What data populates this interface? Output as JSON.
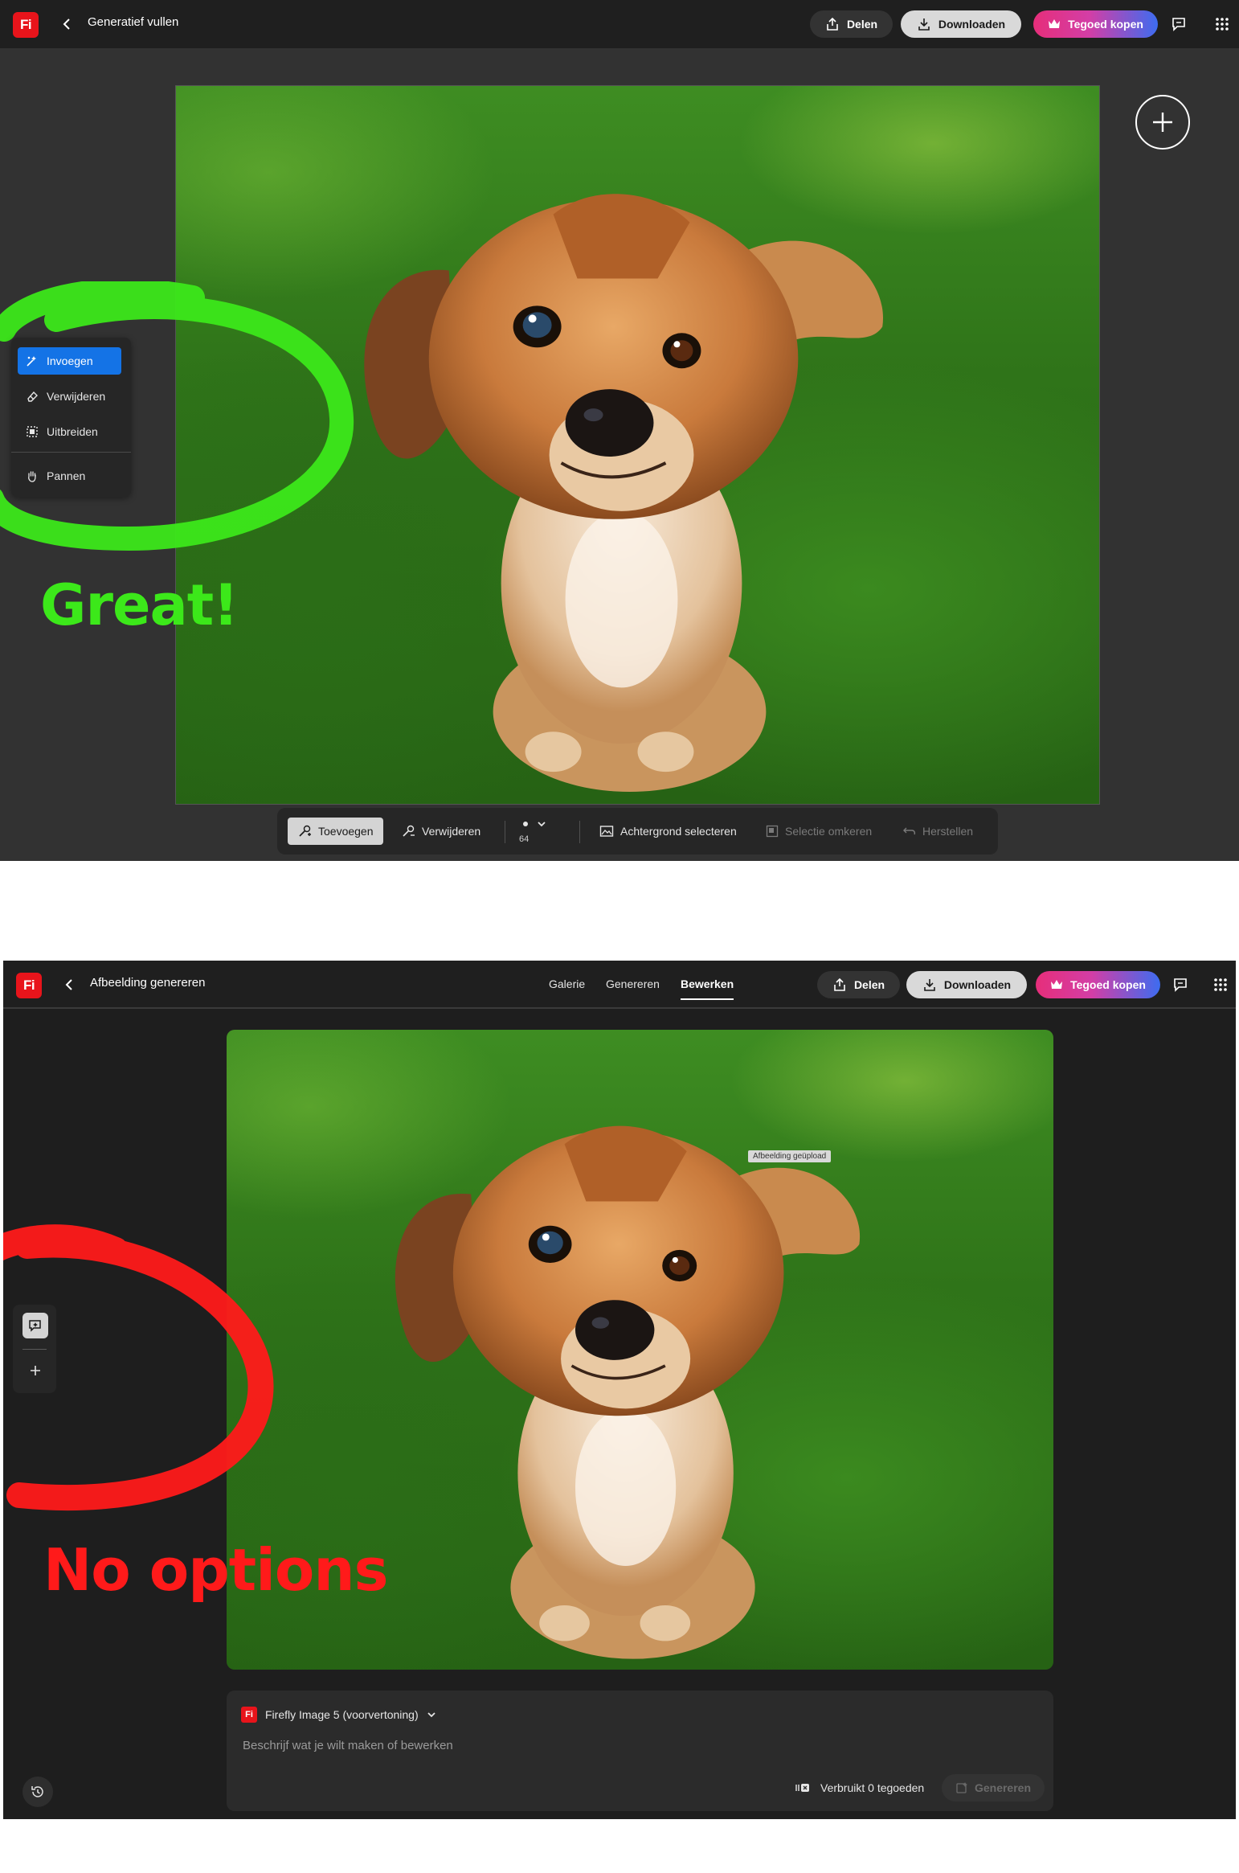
{
  "screen1": {
    "logo": "Fi",
    "title": "Generatief vullen",
    "share_label": "Delen",
    "download_label": "Downloaden",
    "buy_label": "Tegoed kopen",
    "side_tools": [
      {
        "label": "Invoegen",
        "icon": "insert-icon",
        "active": true
      },
      {
        "label": "Verwijderen",
        "icon": "eraser-icon",
        "active": false
      },
      {
        "label": "Uitbreiden",
        "icon": "expand-icon",
        "active": false
      },
      {
        "label": "Pannen",
        "icon": "hand-icon",
        "active": false
      }
    ],
    "bottom_bar": {
      "add_label": "Toevoegen",
      "remove_label": "Verwijderen",
      "brush_size": "64",
      "select_bg_label": "Achtergrond selecteren",
      "invert_label": "Selectie omkeren",
      "reset_label": "Herstellen"
    },
    "annotation": {
      "text": "Great!",
      "color": "#3ce81a"
    }
  },
  "screen2": {
    "logo": "Fi",
    "title": "Afbeelding genereren",
    "tabs": [
      {
        "label": "Galerie",
        "active": false
      },
      {
        "label": "Genereren",
        "active": false
      },
      {
        "label": "Bewerken",
        "active": true
      }
    ],
    "share_label": "Delen",
    "download_label": "Downloaden",
    "buy_label": "Tegoed kopen",
    "tooltip": "Afbeelding geüpload",
    "prompt": {
      "model_logo": "Fi",
      "model": "Firefly Image 5 (voorvertoning)",
      "placeholder": "Beschrijf wat je wilt maken of bewerken",
      "credits": "Verbruikt 0 tegoeden",
      "generate_label": "Genereren"
    },
    "annotation": {
      "text": "No options",
      "color": "#ff1a1a"
    }
  },
  "colors": {
    "adobe_red": "#e8141b",
    "accent_blue": "#1473e6",
    "annotation_green": "#3ce81a",
    "annotation_red": "#ff1a1a"
  }
}
